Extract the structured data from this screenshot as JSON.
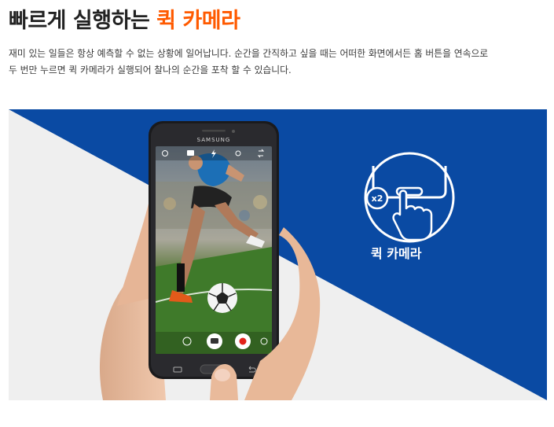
{
  "header": {
    "title_prefix": "빠르게 실행하는 ",
    "title_accent": "퀵 카메라"
  },
  "description": {
    "line1": "재미 있는 일들은 항상 예측할 수 없는 상황에 일어납니다. 순간을 간직하고 싶을 때는 어떠한 화면에서든 홈 버튼을 연속으로",
    "line2": "두 번만 누르면 퀵 카메라가 실행되어 찰나의 순간을 포착 할 수 있습니다."
  },
  "banner": {
    "phone_brand": "SAMSUNG",
    "quick_camera_label": "퀵 카메라",
    "press_count_badge": "x2"
  },
  "colors": {
    "accent": "#ff5a00",
    "banner_blue": "#0a4aa3",
    "banner_light": "#efefef"
  }
}
